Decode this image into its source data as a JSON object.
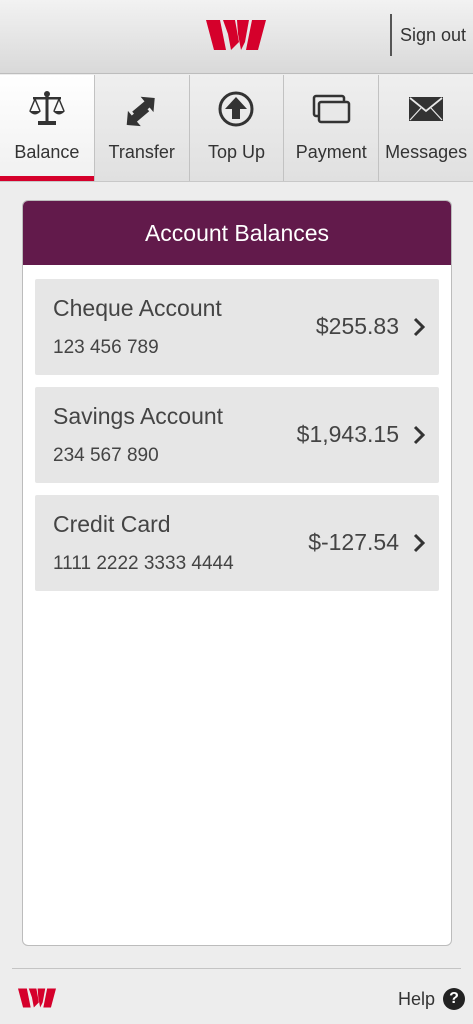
{
  "header": {
    "sign_out_label": "Sign out",
    "brand_color": "#d5002b"
  },
  "tabs": [
    {
      "label": "Balance",
      "icon": "scales-icon",
      "active": true
    },
    {
      "label": "Transfer",
      "icon": "transfer-arrows-icon",
      "active": false
    },
    {
      "label": "Top Up",
      "icon": "up-arrow-circle-icon",
      "active": false
    },
    {
      "label": "Payment",
      "icon": "cards-icon",
      "active": false
    },
    {
      "label": "Messages",
      "icon": "envelope-icon",
      "active": false
    }
  ],
  "card": {
    "title": "Account Balances",
    "header_color": "#621a4b"
  },
  "accounts": [
    {
      "name": "Cheque Account",
      "number": "123 456 789",
      "balance": "$255.83"
    },
    {
      "name": "Savings Account",
      "number": "234 567 890",
      "balance": "$1,943.15"
    },
    {
      "name": "Credit Card",
      "number": "1111 2222 3333 4444",
      "balance": "$-127.54"
    }
  ],
  "footer": {
    "help_label": "Help",
    "help_icon_glyph": "?"
  }
}
